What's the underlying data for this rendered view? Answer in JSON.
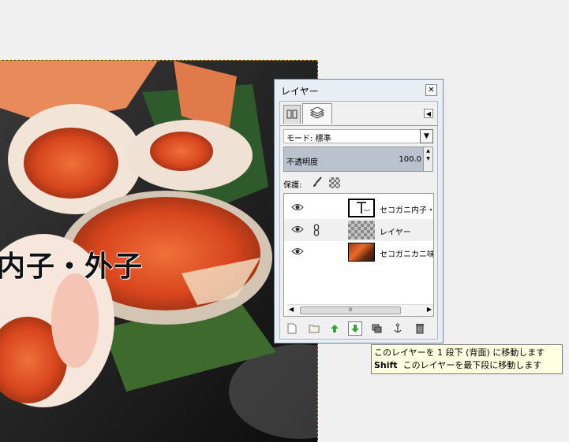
{
  "canvas": {
    "overlay_text": "内子・外子",
    "image_description_icon": "crab-photo"
  },
  "layers_dialog": {
    "title": "レイヤー",
    "close_icon": "close-icon",
    "tabs": [
      {
        "name": "paths-tab",
        "icon": "paths-icon"
      },
      {
        "name": "layers-tab",
        "icon": "layers-icon"
      }
    ],
    "tab_menu_icon": "tab-menu-icon",
    "mode_label": "モード:  標準",
    "opacity_label": "不透明度",
    "opacity_value": "100.0",
    "lock_label": "保護:",
    "layers": [
      {
        "name": "セコガニ内子・外子",
        "thumb": "text",
        "visible": true,
        "selected": false
      },
      {
        "name": "レイヤー",
        "thumb": "checker",
        "visible": true,
        "selected": true,
        "linked": true
      },
      {
        "name": "セコガニカニ味噌",
        "thumb": "photo",
        "visible": true,
        "selected": false
      }
    ],
    "scroll_thumb_label": "III",
    "buttons": [
      {
        "name": "new-layer-button",
        "icon": "new-layer-icon"
      },
      {
        "name": "new-layer-group-button",
        "icon": "folder-icon"
      },
      {
        "name": "raise-layer-button",
        "icon": "arrow-up-icon"
      },
      {
        "name": "lower-layer-button",
        "icon": "arrow-down-icon"
      },
      {
        "name": "duplicate-layer-button",
        "icon": "duplicate-icon"
      },
      {
        "name": "anchor-layer-button",
        "icon": "anchor-icon"
      },
      {
        "name": "delete-layer-button",
        "icon": "trash-icon"
      }
    ]
  },
  "tooltip": {
    "line1": "このレイヤーを 1 段下 (背面) に移動します",
    "line2_key": "Shift",
    "line2_text": "このレイヤーを最下段に移動します"
  },
  "colors": {
    "selection_dash": "#c8a000",
    "opacity_bar": "#bac2cd",
    "raise_arrow": "#3aa23a",
    "tooltip_bg": "#ffffe1"
  }
}
